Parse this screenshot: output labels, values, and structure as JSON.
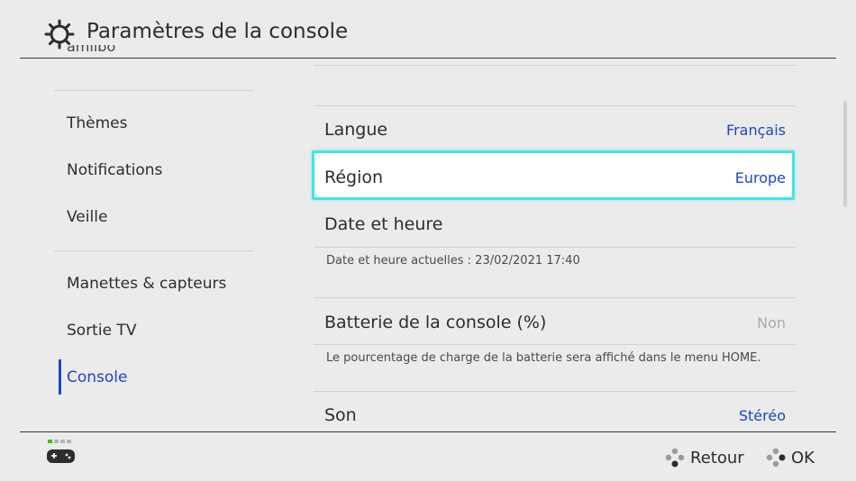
{
  "header": {
    "title": "Paramètres de la console",
    "icon": "gear-icon"
  },
  "sidebar": {
    "cut_item": "amiibo",
    "items": [
      {
        "label": "Thèmes"
      },
      {
        "label": "Notifications"
      },
      {
        "label": "Veille"
      },
      {
        "label": "Manettes & capteurs"
      },
      {
        "label": "Sortie TV"
      },
      {
        "label": "Console",
        "selected": true
      }
    ]
  },
  "main": {
    "langue": {
      "label": "Langue",
      "value": "Français"
    },
    "region": {
      "label": "Région",
      "value": "Europe",
      "focused": true
    },
    "date": {
      "label": "Date et heure",
      "description": "Date et heure actuelles : 23/02/2021 17:40"
    },
    "batterie": {
      "label": "Batterie de la console (%)",
      "value": "Non",
      "description": "Le pourcentage de charge de la batterie sera affiché dans le menu HOME."
    },
    "son": {
      "label": "Son",
      "value": "Stéréo"
    }
  },
  "footer": {
    "back_label": "Retour",
    "ok_label": "OK"
  },
  "colors": {
    "accent": "#1d46c4",
    "focus": "#3ee8e3",
    "background": "#ebebeb"
  }
}
